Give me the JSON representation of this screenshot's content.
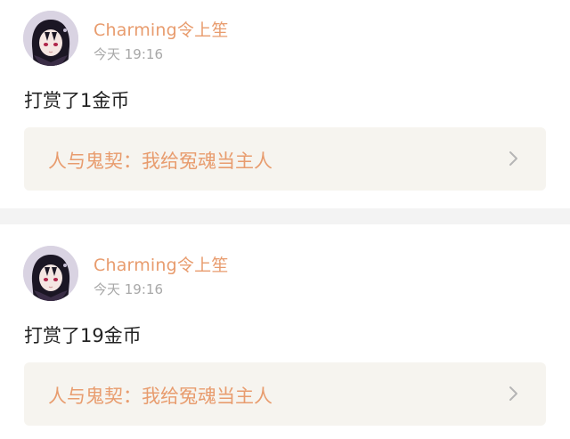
{
  "posts": [
    {
      "username": "Charming令上笙",
      "time": "今天 19:16",
      "content": "打赏了1金币",
      "link_text": "人与鬼契：我给冤魂当主人",
      "avatar_icon": "anime-girl-avatar",
      "chevron_icon": "chevron-right-icon"
    },
    {
      "username": "Charming令上笙",
      "time": "今天 19:16",
      "content": "打赏了19金币",
      "link_text": "人与鬼契：我给冤魂当主人",
      "avatar_icon": "anime-girl-avatar",
      "chevron_icon": "chevron-right-icon"
    }
  ],
  "colors": {
    "accent": "#e89c6e",
    "time": "#a8a8a8",
    "content": "#222222",
    "link_bg": "#f6f4ef",
    "separator": "#f3f3f3"
  }
}
